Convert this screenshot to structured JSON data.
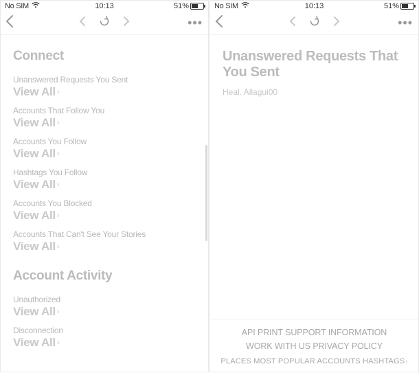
{
  "statusbar": {
    "carrier": "No SIM",
    "time": "10:13",
    "battery_pct": "51%"
  },
  "left": {
    "section1_title": "Connect",
    "rows": [
      {
        "label": "Unanswered Requests You Sent",
        "action": "View All"
      },
      {
        "label": "Accounts That Follow You",
        "action": "View All"
      },
      {
        "label": "Accounts You Follow",
        "action": "View All"
      },
      {
        "label": "Hashtags You Follow",
        "action": "View All"
      },
      {
        "label": "Accounts You Blocked",
        "action": "View All"
      },
      {
        "label": "Accounts That Can't See Your Stories",
        "action": "View All"
      }
    ],
    "section2_title": "Account Activity",
    "rows2": [
      {
        "label": "Unauthorized",
        "action": "View All"
      },
      {
        "label": "Disconnection",
        "action": "View All"
      }
    ]
  },
  "right": {
    "title_line1": "Unanswered Requests That",
    "title_line2": "You Sent",
    "username": "Heal. Allagui00",
    "footer_line1": "API PRINT SUPPORT INFORMATION",
    "footer_line2": "WORK WITH US PRIVACY POLICY",
    "footer_line3": "PLACES MOST POPULAR ACCOUNTS HASHTAGS"
  }
}
